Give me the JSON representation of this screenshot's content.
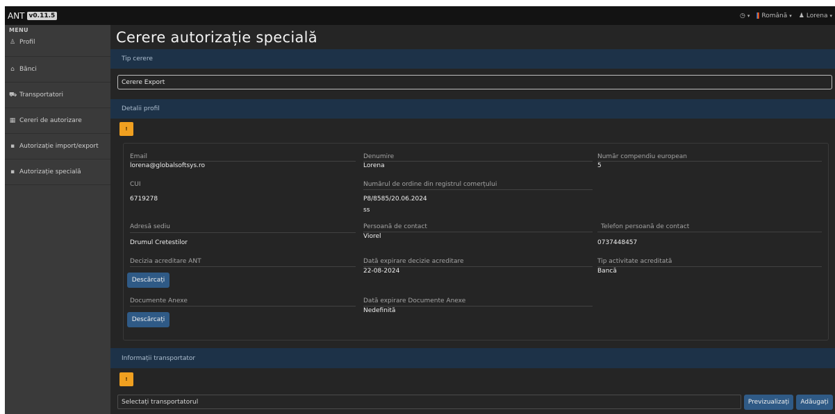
{
  "app": {
    "brand": "ANT",
    "version": "v0.11.5"
  },
  "topbar": {
    "language": "Română",
    "user": "Lorena"
  },
  "sidebar": {
    "menu_title": "MENU",
    "items": [
      {
        "label": "Profil",
        "icon": "user-icon"
      },
      {
        "label": "Bănci",
        "icon": "bank-icon"
      },
      {
        "label": "Transportatori",
        "icon": "truck-icon"
      },
      {
        "label": "Cereri de autorizare",
        "icon": "table-icon"
      },
      {
        "label": "Autorizație import/export",
        "icon": "file-icon"
      },
      {
        "label": "Autorizație specială",
        "icon": "file-icon"
      }
    ]
  },
  "main": {
    "title": "Cerere autorizație specială",
    "request_type": {
      "header": "Tip cerere",
      "value": "Cerere Export"
    },
    "profile": {
      "header": "Detalii profil",
      "warn_label": "!",
      "email": {
        "label": "Email",
        "value": "lorena@globalsoftsys.ro"
      },
      "name": {
        "label": "Denumire",
        "value": "Lorena"
      },
      "eu_number": {
        "label": "Număr compendiu european",
        "value": "5"
      },
      "cui": {
        "label": "CUI",
        "value": "6719278"
      },
      "trade_register": {
        "label": "Numărul de ordine din registrul comerțului",
        "value": "P8/8585/20.06.2024",
        "value2": "ss"
      },
      "address": {
        "label": "Adresă sediu",
        "value": "Drumul Cretestilor"
      },
      "contact": {
        "label": "Persoană de contact",
        "value": "Viorel"
      },
      "contact_phone": {
        "label": "Telefon persoană de contact",
        "value": "0737448457"
      },
      "ant_decision": {
        "label": "Decizia acreditare ANT",
        "button": "Descărcați"
      },
      "decision_expiry": {
        "label": "Dată expirare decizie acreditare",
        "value": "22-08-2024"
      },
      "activity_type": {
        "label": "Tip activitate acreditată",
        "value": "Bancă"
      },
      "annex_docs": {
        "label": "Documente Anexe",
        "button": "Descărcați"
      },
      "annex_expiry": {
        "label": "Dată expirare Documente Anexe",
        "value": "Nedefinită"
      }
    },
    "transporter": {
      "header": "Informații transportator",
      "warn_label": "!",
      "select_placeholder": "Selectați transportatorul",
      "preview_button": "Previzualizați",
      "add_button": "Adăugați"
    }
  },
  "colors": {
    "sidebar": "#3a3a3a",
    "main": "#252525",
    "section": "#1d3248",
    "warning": "#f0a020",
    "button": "#2f5a86"
  }
}
